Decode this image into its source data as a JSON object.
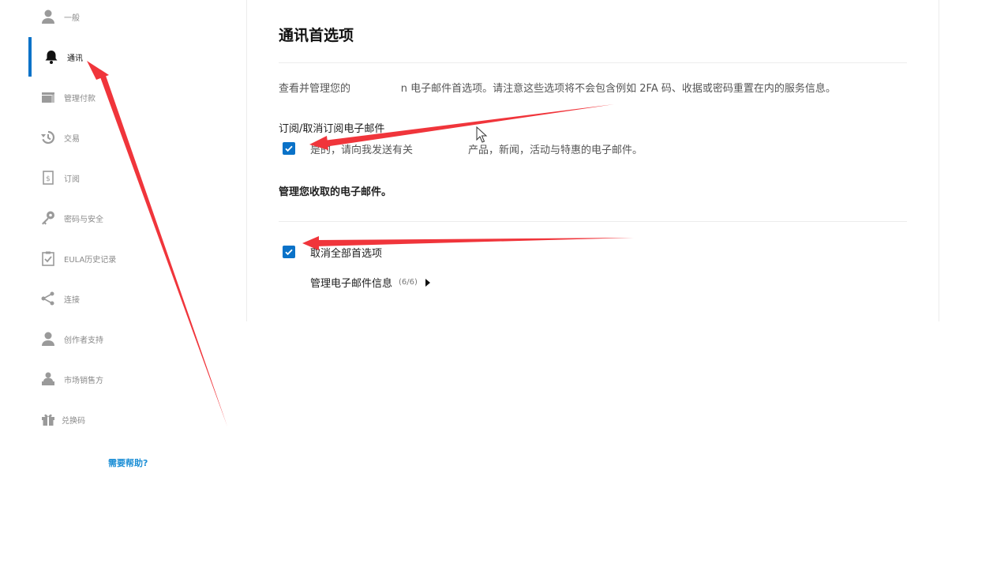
{
  "sidebar": {
    "items": [
      {
        "label": "一般",
        "icon": "person-icon"
      },
      {
        "label": "通讯",
        "icon": "bell-icon",
        "active": true
      },
      {
        "label": "管理付款",
        "icon": "wallet-icon"
      },
      {
        "label": "交易",
        "icon": "history-icon"
      },
      {
        "label": "订阅",
        "icon": "receipt-icon"
      },
      {
        "label": "密码与安全",
        "icon": "key-icon"
      },
      {
        "label": "EULA历史记录",
        "icon": "clipboard-check-icon"
      },
      {
        "label": "连接",
        "icon": "share-icon"
      },
      {
        "label": "创作者支持",
        "icon": "person-icon"
      },
      {
        "label": "市场销售方",
        "icon": "seller-icon"
      },
      {
        "label": "兑换码",
        "icon": "gift-icon"
      }
    ],
    "help_label": "需要帮助?"
  },
  "main": {
    "title": "通讯首选项",
    "description_pre": "查看并管理您的",
    "description_fragment": "n",
    "description_post": "电子邮件首选项。请注意这些选项将不会包含例如 2FA 码、收据或密码重置在内的服务信息。",
    "subscribe_heading": "订阅/取消订阅电子邮件",
    "subscribe_label_pre": "是的，请向我发送有关",
    "subscribe_label_post": "产品，新闻，活动与特惠的电子邮件。",
    "subscribe_checked": true,
    "manage_heading": "管理您收取的电子邮件。",
    "unsubscribe_all_label": "取消全部首选项",
    "unsubscribe_all_checked": true,
    "manage_link_label": "管理电子邮件信息",
    "manage_link_count": "(6/6)"
  },
  "colors": {
    "accent": "#0a72c8",
    "help_link": "#1d8fd6",
    "annotation_arrow": "#f0353b"
  }
}
